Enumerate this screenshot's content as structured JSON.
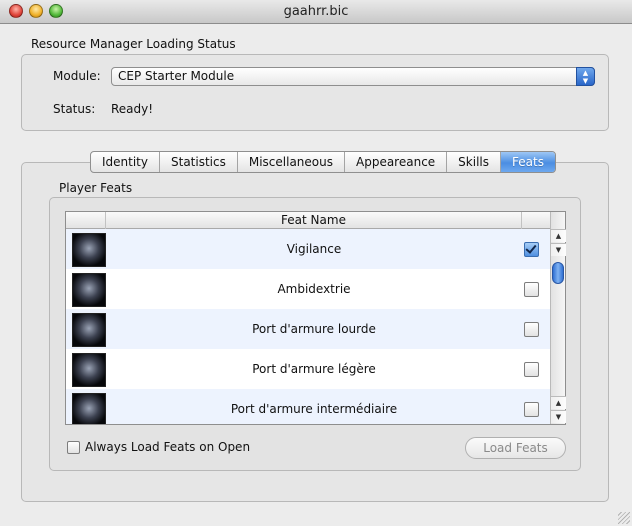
{
  "window": {
    "title": "gaahrr.bic"
  },
  "resource_manager": {
    "group_title": "Resource Manager Loading Status",
    "module_label": "Module:",
    "module_value": "CEP Starter Module",
    "status_label": "Status:",
    "status_value": "Ready!"
  },
  "tabs": [
    {
      "label": "Identity",
      "selected": false
    },
    {
      "label": "Statistics",
      "selected": false
    },
    {
      "label": "Miscellaneous",
      "selected": false
    },
    {
      "label": "Appeareance",
      "selected": false
    },
    {
      "label": "Skills",
      "selected": false
    },
    {
      "label": "Feats",
      "selected": true
    }
  ],
  "player_feats": {
    "group_title": "Player Feats",
    "column_header": "Feat Name",
    "rows": [
      {
        "name": "Vigilance",
        "checked": true,
        "icon": "vigilance-feat-icon"
      },
      {
        "name": "Ambidextrie",
        "checked": false,
        "icon": "ambidextrie-feat-icon"
      },
      {
        "name": "Port d'armure lourde",
        "checked": false,
        "icon": "heavy-armor-feat-icon"
      },
      {
        "name": "Port d'armure légère",
        "checked": false,
        "icon": "light-armor-feat-icon"
      },
      {
        "name": "Port d'armure intermédiaire",
        "checked": false,
        "icon": "medium-armor-feat-icon"
      }
    ],
    "always_load_label": "Always Load Feats on Open",
    "always_load_checked": false,
    "load_button_label": "Load Feats"
  },
  "colors": {
    "selected_tab": "#4b8ee2",
    "alt_row": "#edf3fe",
    "window_bg": "#ececec"
  }
}
